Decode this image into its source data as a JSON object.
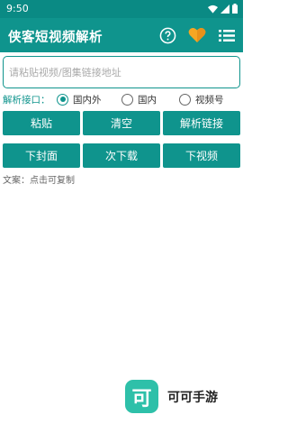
{
  "status": {
    "time": "9:50"
  },
  "app": {
    "title": "侠客短视频解析"
  },
  "input": {
    "placeholder": "请粘贴视频/图集链接地址",
    "value": ""
  },
  "api": {
    "label": "解析接口：",
    "options": [
      "国内外",
      "国内",
      "视频号"
    ],
    "selected": "国内外"
  },
  "buttons": {
    "paste": "粘贴",
    "clear": "清空",
    "parse": "解析链接",
    "download_cover": "下封面",
    "download_next": "次下载",
    "download_video": "下视频"
  },
  "caption": "文案：点击可复制",
  "watermark": {
    "logo_char": "可",
    "name": "可可手游"
  },
  "colors": {
    "primary": "#0f948d",
    "status_bar": "#0a8a84",
    "heart": "#f5a623",
    "watermark_logo": "#2ec0a9"
  },
  "icons": [
    "help-icon",
    "heart-icon",
    "menu-list-icon",
    "wifi-icon",
    "signal-icon",
    "battery-icon"
  ]
}
